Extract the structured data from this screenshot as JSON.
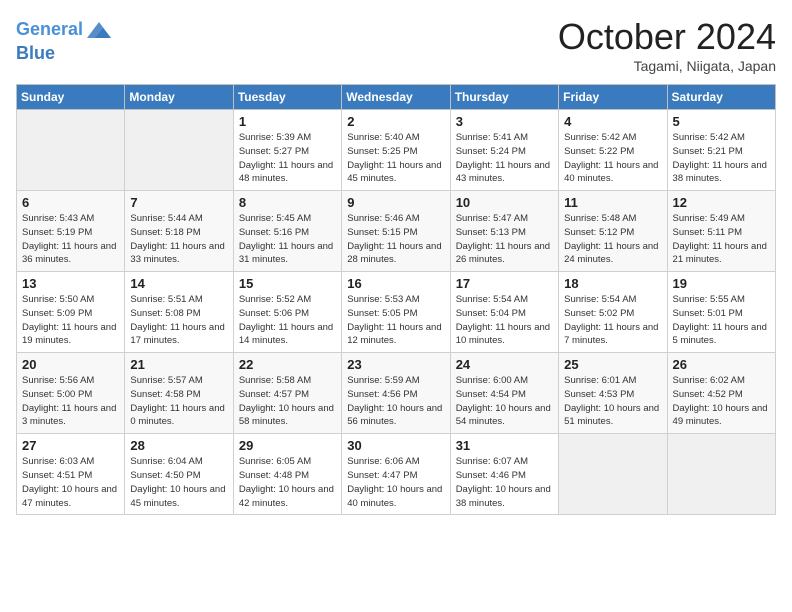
{
  "header": {
    "logo_line1": "General",
    "logo_line2": "Blue",
    "month_title": "October 2024",
    "location": "Tagami, Niigata, Japan"
  },
  "weekdays": [
    "Sunday",
    "Monday",
    "Tuesday",
    "Wednesday",
    "Thursday",
    "Friday",
    "Saturday"
  ],
  "weeks": [
    [
      {
        "day": "",
        "empty": true
      },
      {
        "day": "",
        "empty": true
      },
      {
        "day": "1",
        "sunrise": "5:39 AM",
        "sunset": "5:27 PM",
        "daylight": "11 hours and 48 minutes."
      },
      {
        "day": "2",
        "sunrise": "5:40 AM",
        "sunset": "5:25 PM",
        "daylight": "11 hours and 45 minutes."
      },
      {
        "day": "3",
        "sunrise": "5:41 AM",
        "sunset": "5:24 PM",
        "daylight": "11 hours and 43 minutes."
      },
      {
        "day": "4",
        "sunrise": "5:42 AM",
        "sunset": "5:22 PM",
        "daylight": "11 hours and 40 minutes."
      },
      {
        "day": "5",
        "sunrise": "5:42 AM",
        "sunset": "5:21 PM",
        "daylight": "11 hours and 38 minutes."
      }
    ],
    [
      {
        "day": "6",
        "sunrise": "5:43 AM",
        "sunset": "5:19 PM",
        "daylight": "11 hours and 36 minutes."
      },
      {
        "day": "7",
        "sunrise": "5:44 AM",
        "sunset": "5:18 PM",
        "daylight": "11 hours and 33 minutes."
      },
      {
        "day": "8",
        "sunrise": "5:45 AM",
        "sunset": "5:16 PM",
        "daylight": "11 hours and 31 minutes."
      },
      {
        "day": "9",
        "sunrise": "5:46 AM",
        "sunset": "5:15 PM",
        "daylight": "11 hours and 28 minutes."
      },
      {
        "day": "10",
        "sunrise": "5:47 AM",
        "sunset": "5:13 PM",
        "daylight": "11 hours and 26 minutes."
      },
      {
        "day": "11",
        "sunrise": "5:48 AM",
        "sunset": "5:12 PM",
        "daylight": "11 hours and 24 minutes."
      },
      {
        "day": "12",
        "sunrise": "5:49 AM",
        "sunset": "5:11 PM",
        "daylight": "11 hours and 21 minutes."
      }
    ],
    [
      {
        "day": "13",
        "sunrise": "5:50 AM",
        "sunset": "5:09 PM",
        "daylight": "11 hours and 19 minutes."
      },
      {
        "day": "14",
        "sunrise": "5:51 AM",
        "sunset": "5:08 PM",
        "daylight": "11 hours and 17 minutes."
      },
      {
        "day": "15",
        "sunrise": "5:52 AM",
        "sunset": "5:06 PM",
        "daylight": "11 hours and 14 minutes."
      },
      {
        "day": "16",
        "sunrise": "5:53 AM",
        "sunset": "5:05 PM",
        "daylight": "11 hours and 12 minutes."
      },
      {
        "day": "17",
        "sunrise": "5:54 AM",
        "sunset": "5:04 PM",
        "daylight": "11 hours and 10 minutes."
      },
      {
        "day": "18",
        "sunrise": "5:54 AM",
        "sunset": "5:02 PM",
        "daylight": "11 hours and 7 minutes."
      },
      {
        "day": "19",
        "sunrise": "5:55 AM",
        "sunset": "5:01 PM",
        "daylight": "11 hours and 5 minutes."
      }
    ],
    [
      {
        "day": "20",
        "sunrise": "5:56 AM",
        "sunset": "5:00 PM",
        "daylight": "11 hours and 3 minutes."
      },
      {
        "day": "21",
        "sunrise": "5:57 AM",
        "sunset": "4:58 PM",
        "daylight": "11 hours and 0 minutes."
      },
      {
        "day": "22",
        "sunrise": "5:58 AM",
        "sunset": "4:57 PM",
        "daylight": "10 hours and 58 minutes."
      },
      {
        "day": "23",
        "sunrise": "5:59 AM",
        "sunset": "4:56 PM",
        "daylight": "10 hours and 56 minutes."
      },
      {
        "day": "24",
        "sunrise": "6:00 AM",
        "sunset": "4:54 PM",
        "daylight": "10 hours and 54 minutes."
      },
      {
        "day": "25",
        "sunrise": "6:01 AM",
        "sunset": "4:53 PM",
        "daylight": "10 hours and 51 minutes."
      },
      {
        "day": "26",
        "sunrise": "6:02 AM",
        "sunset": "4:52 PM",
        "daylight": "10 hours and 49 minutes."
      }
    ],
    [
      {
        "day": "27",
        "sunrise": "6:03 AM",
        "sunset": "4:51 PM",
        "daylight": "10 hours and 47 minutes."
      },
      {
        "day": "28",
        "sunrise": "6:04 AM",
        "sunset": "4:50 PM",
        "daylight": "10 hours and 45 minutes."
      },
      {
        "day": "29",
        "sunrise": "6:05 AM",
        "sunset": "4:48 PM",
        "daylight": "10 hours and 42 minutes."
      },
      {
        "day": "30",
        "sunrise": "6:06 AM",
        "sunset": "4:47 PM",
        "daylight": "10 hours and 40 minutes."
      },
      {
        "day": "31",
        "sunrise": "6:07 AM",
        "sunset": "4:46 PM",
        "daylight": "10 hours and 38 minutes."
      },
      {
        "day": "",
        "empty": true
      },
      {
        "day": "",
        "empty": true
      }
    ]
  ]
}
